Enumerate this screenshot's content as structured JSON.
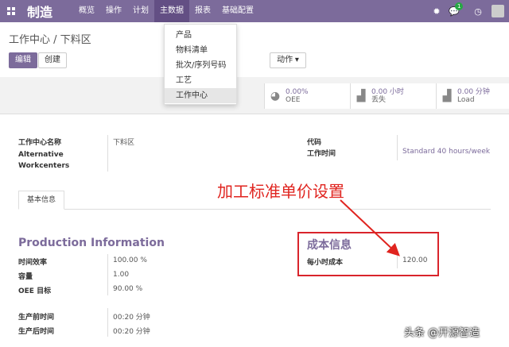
{
  "topbar": {
    "app_title": "制造",
    "menu": [
      "概览",
      "操作",
      "计划",
      "主数据",
      "报表",
      "基础配置"
    ],
    "chat_badge": "1",
    "colors": {
      "brand": "#7c6b9b",
      "active": "#634f84",
      "badge": "#28a745"
    }
  },
  "icons": [
    "apps-grid-icon",
    "bug-icon",
    "chat-icon",
    "clock-icon"
  ],
  "breadcrumb": "工作中心 / 下料区",
  "buttons": {
    "edit": "编辑",
    "create": "创建",
    "action": "动作"
  },
  "dropdown": [
    "产品",
    "物料清单",
    "批次/序列号码",
    "工艺",
    "工作中心"
  ],
  "stats": [
    {
      "value": "0.00%",
      "label": "OEE"
    },
    {
      "value": "0.00 小时",
      "label": "丢失"
    },
    {
      "value": "0.00 分钟",
      "label": "Load"
    }
  ],
  "form": {
    "name_label": "工作中心名称",
    "name_value": "下料区",
    "alt_label_1": "Alternative",
    "alt_label_2": "Workcenters",
    "code_label": "代码",
    "worktime_label": "工作时间",
    "worktime_value": "Standard 40 hours/week"
  },
  "tab": "基本信息",
  "production": {
    "title": "Production Information",
    "rows": [
      {
        "label": "时间效率",
        "value": "100.00  %"
      },
      {
        "label": "容量",
        "value": "1.00"
      },
      {
        "label": "OEE 目标",
        "value": "90.00  %"
      },
      {
        "label": "生产前时间",
        "value": "00:20 分钟"
      },
      {
        "label": "生产后时间",
        "value": "00:20 分钟"
      }
    ]
  },
  "cost": {
    "title": "成本信息",
    "label": "每小时成本",
    "value": "120.00"
  },
  "annotation": "加工标准单价设置",
  "watermark": "头条 @开源智造"
}
